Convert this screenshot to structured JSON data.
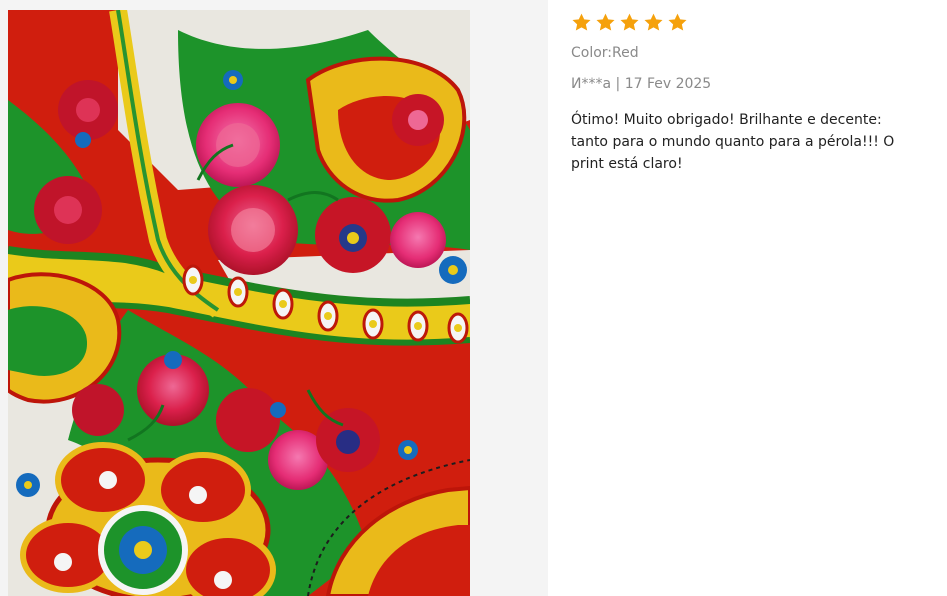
{
  "review": {
    "rating": 5,
    "rating_max": 5,
    "star_color": "#f5a10c",
    "variant": "Color:Red",
    "author": "И***а",
    "separator": "|",
    "date": "17 Fev 2025",
    "text": "Ótimo! Muito obrigado! Brilhante e decente: tanto para o mundo quanto para a pérola!!! O print está claro!",
    "photo": {
      "description_icon": "review-photo",
      "palette": [
        "#d81e12",
        "#1f9a2c",
        "#f4d31c",
        "#ef2f58",
        "#ffffff",
        "#1670c5"
      ]
    }
  }
}
